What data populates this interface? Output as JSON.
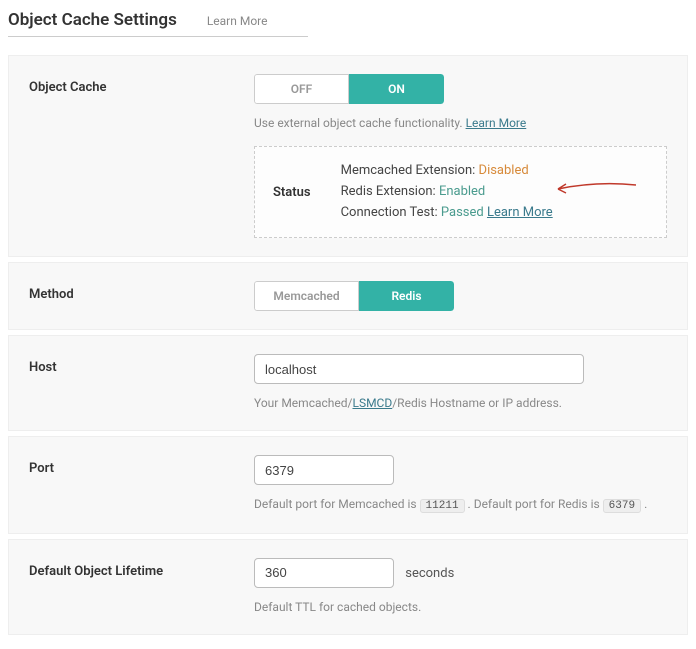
{
  "header": {
    "title": "Object Cache Settings",
    "learn_more": "Learn More"
  },
  "object_cache": {
    "label": "Object Cache",
    "off": "OFF",
    "on": "ON",
    "helper": "Use external object cache functionality. ",
    "helper_link": "Learn More",
    "status_label": "Status",
    "memcached_label": "Memcached Extension: ",
    "memcached_status": "Disabled",
    "redis_label": "Redis Extension: ",
    "redis_status": "Enabled",
    "connection_label": "Connection Test: ",
    "connection_status": "Passed",
    "connection_link": "Learn More"
  },
  "method": {
    "label": "Method",
    "memcached": "Memcached",
    "redis": "Redis"
  },
  "host": {
    "label": "Host",
    "value": "localhost",
    "helper_pre": "Your Memcached/",
    "helper_link": "LSMCD",
    "helper_post": "/Redis Hostname or IP address."
  },
  "port": {
    "label": "Port",
    "value": "6379",
    "helper_pre": "Default port for Memcached is ",
    "memcached_port": "11211",
    "helper_mid": ". Default port for Redis is ",
    "redis_port": "6379",
    "helper_post": "."
  },
  "lifetime": {
    "label": "Default Object Lifetime",
    "value": "360",
    "suffix": "seconds",
    "helper": "Default TTL for cached objects."
  }
}
